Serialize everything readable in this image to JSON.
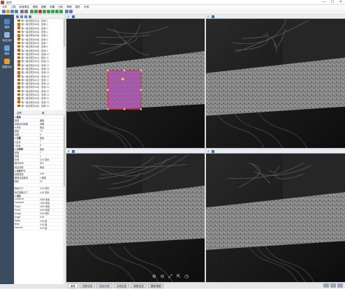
{
  "window": {
    "title": "软件",
    "minimize": "—",
    "maximize": "☐",
    "close": "✕"
  },
  "menu": [
    "文件",
    "工具",
    "标准项目",
    "视图",
    "图像",
    "设置",
    "分析",
    "帮助",
    "插件",
    "示例"
  ],
  "toolbar": {
    "icons": [
      "new-icon",
      "open-icon",
      "save-icon",
      "save-as-icon",
      "undo-icon",
      "redo-icon",
      "play-icon",
      "pause-icon",
      "stop-icon",
      "step-icon",
      "capture-icon",
      "camera-icon",
      "grid-icon",
      "measure-icon",
      "layers-icon",
      "export-icon"
    ]
  },
  "nav": {
    "items": [
      {
        "label": "图像",
        "icon": "image-icon",
        "color": "#4a86c5"
      },
      {
        "label": "标定分析",
        "icon": "list-icon",
        "color": "#8fb6e0"
      },
      {
        "label": "图表",
        "icon": "chart-icon",
        "color": "#6aa0d8"
      },
      {
        "label": "数据分析",
        "icon": "analysis-icon",
        "color": "#e0a030"
      }
    ]
  },
  "files": {
    "rows": [
      {
        "name": "第一组试样[0001]",
        "size": "图像 1"
      },
      {
        "name": "第一组试样[0002]",
        "size": "图像 2"
      },
      {
        "name": "第一组试样[0003]",
        "size": "图像 3"
      },
      {
        "name": "第一组试样[0004]",
        "size": "图像 4"
      },
      {
        "name": "第一组试样[0005]",
        "size": "图像 5"
      },
      {
        "name": "第一组试样[0006]",
        "size": "图像 6"
      },
      {
        "name": "第一组试样[0007]",
        "size": "图像 7"
      },
      {
        "name": "第一组试样[0008]",
        "size": "图像 8"
      },
      {
        "name": "第一组试样[0009]",
        "size": "图像 9"
      },
      {
        "name": "第一组试样[0010]",
        "size": "图像 10"
      },
      {
        "name": "第一组试样[0011]",
        "size": "图像 11"
      },
      {
        "name": "第一组试样[0012]",
        "size": "图像 12"
      },
      {
        "name": "第一组试样[0013]",
        "size": "图像 13"
      },
      {
        "name": "第一组试样[0014]",
        "size": "图像 14"
      },
      {
        "name": "第一组试样[0015]",
        "size": "图像 15"
      },
      {
        "name": "第一组试样[0016]",
        "size": "图像 16"
      },
      {
        "name": "第一组试样[0017]",
        "size": "图像 17"
      },
      {
        "name": "第一组试样[0018]",
        "size": "图像 18"
      },
      {
        "name": "第一组试样[0019]",
        "size": "图像 19"
      },
      {
        "name": "第一组试样[0020]",
        "size": "图像 20"
      },
      {
        "name": "第一组试样[0021]",
        "size": "图像 21"
      },
      {
        "name": "第一组试样[0022]",
        "size": "图像 22"
      },
      {
        "name": "第一组试样[0023]",
        "size": "图像 23"
      },
      {
        "name": "第一组试样[0024]",
        "size": "图像 24"
      }
    ]
  },
  "properties": {
    "headers": [
      "名称",
      "值"
    ],
    "rows": [
      {
        "k": "▾ 基础",
        "v": "",
        "group": true
      },
      {
        "k": "  类型",
        "v": "图像"
      },
      {
        "k": "  采集时间间隔",
        "v": "间隔"
      },
      {
        "k": "▾ 尺寸",
        "v": "像素",
        "group": true
      },
      {
        "k": "    宽度",
        "v": "73"
      },
      {
        "k": "    高度",
        "v": "6"
      },
      {
        "k": "▾ 位置",
        "v": "像素",
        "group": true
      },
      {
        "k": "    X坐标",
        "v": "7"
      },
      {
        "k": "    Y坐标",
        "v": "8"
      },
      {
        "k": "▾ 分辨率",
        "v": "像素",
        "group": true
      },
      {
        "k": "    宽度",
        "v": "1"
      },
      {
        "k": "    高度",
        "v": "1"
      },
      {
        "k": "  比例",
        "v": "0.10 毫米"
      },
      {
        "k": "  曝光时间",
        "v": "ROI"
      },
      {
        "k": "  增益系数",
        "v": "像素"
      },
      {
        "k": "▾ 全局尺寸",
        "v": "",
        "group": true
      },
      {
        "k": "  参数数量",
        "v": "0.00"
      },
      {
        "k": "  图像位置数量",
        "v": "1 图像"
      },
      {
        "k": "  相机",
        "v": "24"
      },
      {
        "k": "",
        "v": ""
      },
      {
        "k": "  像素尺寸",
        "v": "0.00 毫米"
      },
      {
        "k": "  单位图像尺寸",
        "v": "0.00 毫米"
      },
      {
        "k": "▾ 相机",
        "v": "",
        "group": true
      },
      {
        "k": "  Camera1",
        "v": "2048 像素"
      },
      {
        "k": "  Camera2",
        "v": "1536 像素"
      },
      {
        "k": "  Pixel1",
        "v": "1000 像素"
      },
      {
        "k": "  Pixel2",
        "v": "1000 像素"
      },
      {
        "k": "  Height",
        "v": "0.00 毫米"
      },
      {
        "k": "  Angle",
        "v": "0.00"
      },
      {
        "k": "  Alpha",
        "v": "0.00 度"
      },
      {
        "k": "  Beta",
        "v": "0.00 度"
      },
      {
        "k": "  Gamma",
        "v": "0.00 度"
      }
    ]
  },
  "viewports": [
    {
      "tab": "1",
      "roi": true
    },
    {
      "tab": "2",
      "roi": false
    },
    {
      "tab": "3",
      "roi": false
    },
    {
      "tab": "4",
      "roi": false
    }
  ],
  "zoom": [
    "⊕",
    "⊖",
    "⤢",
    "⇱",
    "◷"
  ],
  "bottom_tabs": [
    "图像",
    "位移/应变",
    "标定/分析",
    "点线/应变",
    "图表/应变",
    "图像/视频"
  ],
  "colors": {
    "roi_fill": "#b04ab8",
    "roi_edge": "#d0302e",
    "nav_bg": "#3b4b60",
    "accent": "#2f6fd1"
  }
}
